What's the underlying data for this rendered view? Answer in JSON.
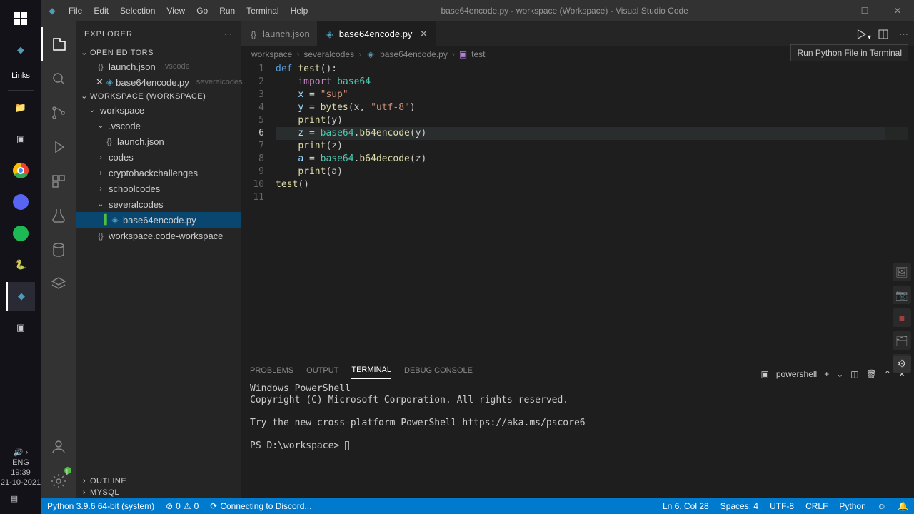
{
  "window_title": "base64encode.py - workspace (Workspace) - Visual Studio Code",
  "menu": [
    "File",
    "Edit",
    "Selection",
    "View",
    "Go",
    "Run",
    "Terminal",
    "Help"
  ],
  "taskbar": {
    "links_label": "Links",
    "lang": "ENG",
    "time": "19:39",
    "date": "21-10-2021"
  },
  "explorer": {
    "title": "EXPLORER",
    "open_editors": "OPEN EDITORS",
    "workspace_hdr": "WORKSPACE (WORKSPACE)",
    "files": {
      "launch": "launch.json",
      "launch_desc": ".vscode",
      "b64": "base64encode.py",
      "b64_desc": "severalcodes"
    },
    "tree": {
      "root": "workspace",
      "vscode": ".vscode",
      "codes": "codes",
      "crypto": "cryptohackchallenges",
      "school": "schoolcodes",
      "several": "severalcodes",
      "b64": "base64encode.py",
      "ws": "workspace.code-workspace"
    },
    "outline": "OUTLINE",
    "mysql": "MYSQL"
  },
  "tabs": {
    "launch": "launch.json",
    "b64": "base64encode.py"
  },
  "breadcrumb": {
    "a": "workspace",
    "b": "severalcodes",
    "c": "base64encode.py",
    "d": "test"
  },
  "tooltip": "Run Python File in Terminal",
  "active_line": "6",
  "code": {
    "l1_def": "def",
    "l1_name": "test",
    "l1_paren": "():",
    "l2_imp": "import",
    "l2_mod": "base64",
    "l3_v": "x",
    "l3_eq": " = ",
    "l3_s": "\"sup\"",
    "l4_v": "y",
    "l4_eq": " = ",
    "l4_fn": "bytes",
    "l4_a": "(x, ",
    "l4_s": "\"utf-8\"",
    "l4_b": ")",
    "l5_fn": "print",
    "l5_a": "(y)",
    "l6_v": "z",
    "l6_eq": " = ",
    "l6_m": "base64",
    "l6_d": ".",
    "l6_fn": "b64encode",
    "l6_a": "(y)",
    "l7_fn": "print",
    "l7_a": "(z)",
    "l8_v": "a",
    "l8_eq": " = ",
    "l8_m": "base64",
    "l8_d": ".",
    "l8_fn": "b64decode",
    "l8_a": "(z)",
    "l9_fn": "print",
    "l9_a": "(a)",
    "l10_fn": "test",
    "l10_a": "()"
  },
  "panel": {
    "problems": "PROBLEMS",
    "output": "OUTPUT",
    "terminal": "TERMINAL",
    "debug": "DEBUG CONSOLE",
    "shell": "powershell"
  },
  "terminal": {
    "l1": "Windows PowerShell",
    "l2": "Copyright (C) Microsoft Corporation. All rights reserved.",
    "l3": "Try the new cross-platform PowerShell https://aka.ms/pscore6",
    "prompt": "PS D:\\workspace> "
  },
  "status": {
    "py": "Python 3.9.6 64-bit (system)",
    "err": "0",
    "warn": "0",
    "discord": "Connecting to Discord...",
    "pos": "Ln 6, Col 28",
    "spaces": "Spaces: 4",
    "enc": "UTF-8",
    "eol": "CRLF",
    "lang": "Python"
  }
}
